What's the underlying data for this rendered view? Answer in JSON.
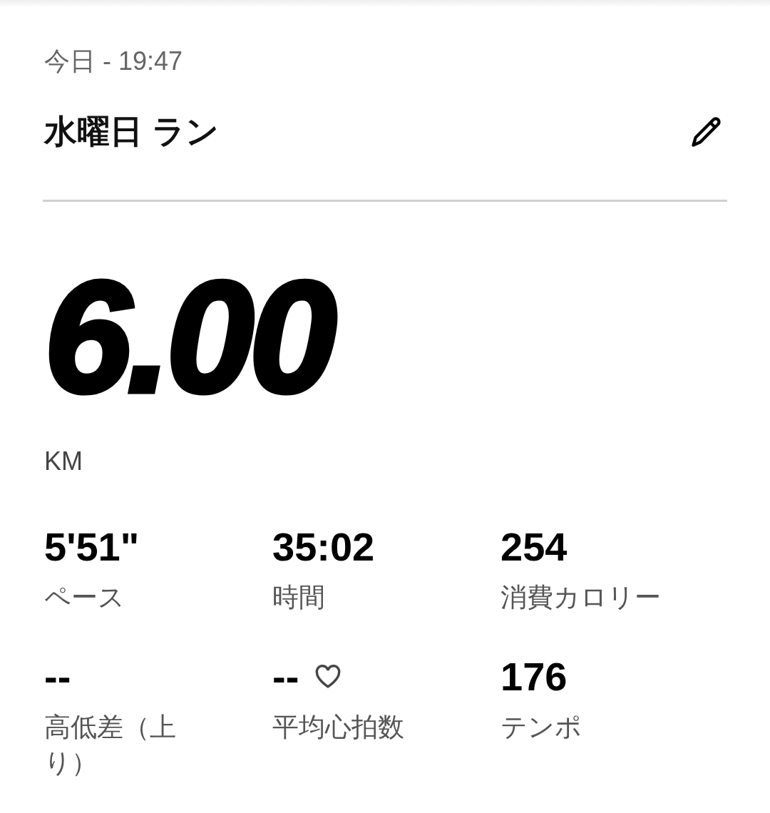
{
  "header": {
    "date": "今日 - 19:47",
    "title": "水曜日 ラン"
  },
  "distance": {
    "value": "6.00",
    "unit": "KM"
  },
  "stats": [
    {
      "kind": "plain",
      "value": "5'51\"",
      "label": "ペース"
    },
    {
      "kind": "plain",
      "value": "35:02",
      "label": "時間"
    },
    {
      "kind": "plain",
      "value": "254",
      "label": "消費カロリー"
    },
    {
      "kind": "plain",
      "value": "--",
      "label": "高低差（上り）"
    },
    {
      "kind": "heart",
      "value": "--",
      "label": "平均心拍数"
    },
    {
      "kind": "plain",
      "value": "176",
      "label": "テンポ"
    }
  ]
}
